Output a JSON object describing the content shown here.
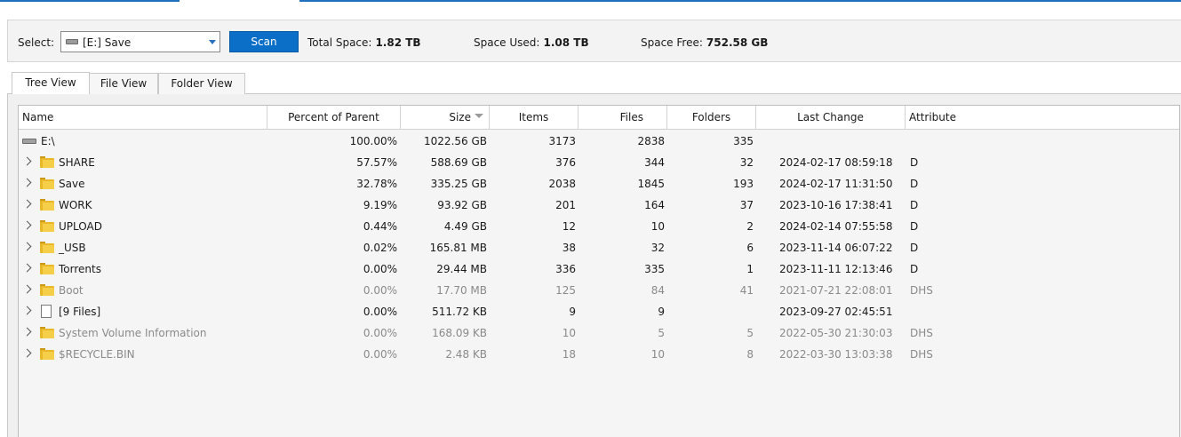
{
  "toolbar": {
    "select_label": "Select:",
    "selected_drive": "[E:] Save",
    "scan_label": "Scan",
    "total_space_label": "Total Space:",
    "total_space_value": "1.82 TB",
    "space_used_label": "Space Used:",
    "space_used_value": "1.08 TB",
    "space_free_label": "Space Free:",
    "space_free_value": "752.58 GB"
  },
  "tabs": [
    {
      "label": "Tree View",
      "active": true
    },
    {
      "label": "File View",
      "active": false
    },
    {
      "label": "Folder View",
      "active": false
    }
  ],
  "columns": {
    "name": "Name",
    "percent": "Percent of Parent",
    "size": "Size",
    "items": "Items",
    "files": "Files",
    "folders": "Folders",
    "last_change": "Last Change",
    "attribute": "Attribute"
  },
  "rows": [
    {
      "name": "E:\\",
      "percent": "100.00%",
      "size": "1022.56 GB",
      "items": "3173",
      "files": "2838",
      "folders": "335",
      "last_change": "",
      "attribute": "",
      "icon": "drive-icon",
      "dim": false
    },
    {
      "name": "SHARE",
      "percent": "57.57%",
      "size": "588.69 GB",
      "items": "376",
      "files": "344",
      "folders": "32",
      "last_change": "2024-02-17 08:59:18",
      "attribute": "D",
      "icon": "folder-icon",
      "dim": false
    },
    {
      "name": "Save",
      "percent": "32.78%",
      "size": "335.25 GB",
      "items": "2038",
      "files": "1845",
      "folders": "193",
      "last_change": "2024-02-17 11:31:50",
      "attribute": "D",
      "icon": "folder-icon",
      "dim": false
    },
    {
      "name": "WORK",
      "percent": "9.19%",
      "size": "93.92 GB",
      "items": "201",
      "files": "164",
      "folders": "37",
      "last_change": "2023-10-16 17:38:41",
      "attribute": "D",
      "icon": "folder-icon",
      "dim": false
    },
    {
      "name": "UPLOAD",
      "percent": "0.44%",
      "size": "4.49 GB",
      "items": "12",
      "files": "10",
      "folders": "2",
      "last_change": "2024-02-14 07:55:58",
      "attribute": "D",
      "icon": "folder-icon",
      "dim": false
    },
    {
      "name": "_USB",
      "percent": "0.02%",
      "size": "165.81 MB",
      "items": "38",
      "files": "32",
      "folders": "6",
      "last_change": "2023-11-14 06:07:22",
      "attribute": "D",
      "icon": "folder-icon",
      "dim": false
    },
    {
      "name": "Torrents",
      "percent": "0.00%",
      "size": "29.44 MB",
      "items": "336",
      "files": "335",
      "folders": "1",
      "last_change": "2023-11-11 12:13:46",
      "attribute": "D",
      "icon": "folder-icon",
      "dim": false
    },
    {
      "name": "Boot",
      "percent": "0.00%",
      "size": "17.70 MB",
      "items": "125",
      "files": "84",
      "folders": "41",
      "last_change": "2021-07-21 22:08:01",
      "attribute": "DHS",
      "icon": "folder-icon",
      "dim": true
    },
    {
      "name": "[9 Files]",
      "percent": "0.00%",
      "size": "511.72 KB",
      "items": "9",
      "files": "9",
      "folders": "",
      "last_change": "2023-09-27 02:45:51",
      "attribute": "",
      "icon": "file-icon",
      "dim": false
    },
    {
      "name": "System Volume Information",
      "percent": "0.00%",
      "size": "168.09 KB",
      "items": "10",
      "files": "5",
      "folders": "5",
      "last_change": "2022-05-30 21:30:03",
      "attribute": "DHS",
      "icon": "folder-icon",
      "dim": true
    },
    {
      "name": "$RECYCLE.BIN",
      "percent": "0.00%",
      "size": "2.48 KB",
      "items": "18",
      "files": "10",
      "folders": "8",
      "last_change": "2022-03-30 13:03:38",
      "attribute": "DHS",
      "icon": "folder-icon",
      "dim": true
    }
  ]
}
